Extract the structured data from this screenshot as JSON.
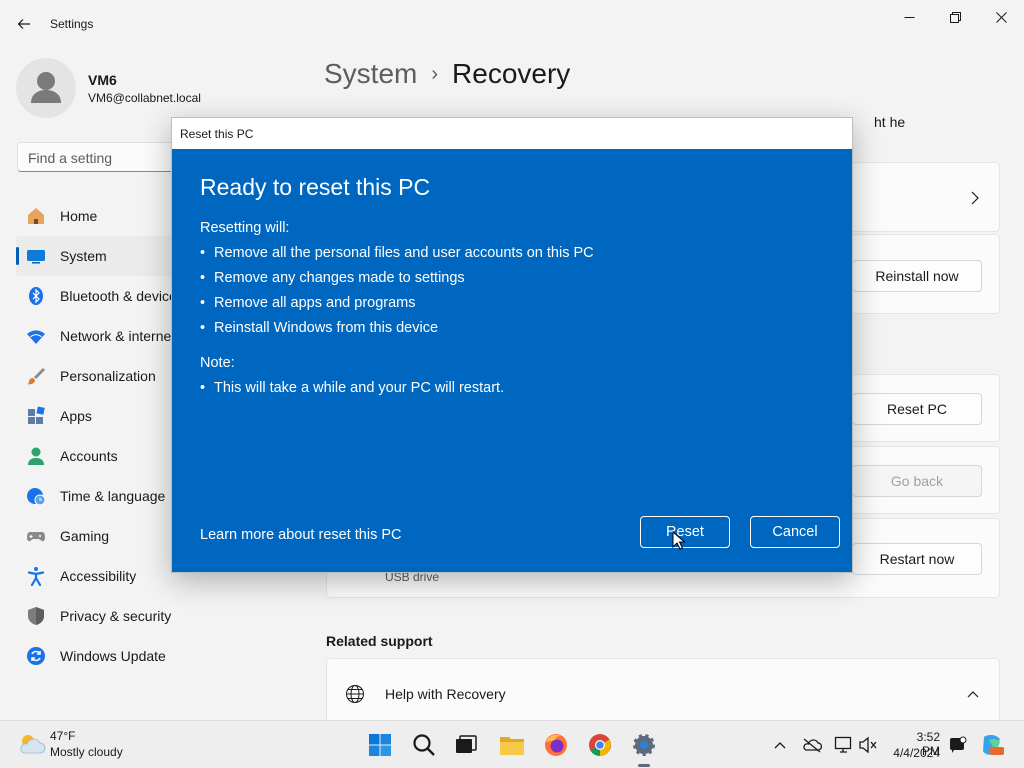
{
  "window": {
    "title": "Settings",
    "minimize_glyph": "—",
    "maximize_glyph": "❐",
    "close_glyph": "✕"
  },
  "user": {
    "name": "VM6",
    "email": "VM6@collabnet.local"
  },
  "search": {
    "placeholder": "Find a setting"
  },
  "sidebar": {
    "items": [
      {
        "label": "Home",
        "icon": "home-icon"
      },
      {
        "label": "System",
        "icon": "system-icon",
        "active": true
      },
      {
        "label": "Bluetooth & devices",
        "icon": "bluetooth-icon"
      },
      {
        "label": "Network & internet",
        "icon": "wifi-icon"
      },
      {
        "label": "Personalization",
        "icon": "brush-icon"
      },
      {
        "label": "Apps",
        "icon": "apps-icon"
      },
      {
        "label": "Accounts",
        "icon": "accounts-icon"
      },
      {
        "label": "Time & language",
        "icon": "globe-clock-icon"
      },
      {
        "label": "Gaming",
        "icon": "gamepad-icon"
      },
      {
        "label": "Accessibility",
        "icon": "accessibility-icon"
      },
      {
        "label": "Privacy & security",
        "icon": "shield-icon"
      },
      {
        "label": "Windows Update",
        "icon": "update-icon"
      }
    ]
  },
  "main": {
    "breadcrumb_parent": "System",
    "breadcrumb_current": "Recovery",
    "intro_tail": "ht help.",
    "reinstall_button": "Reinstall now",
    "reset_button": "Reset PC",
    "goback_button": "Go back",
    "restart_button": "Restart now",
    "advanced_sub": "USB drive",
    "related_support_title": "Related support",
    "help_with_recovery": "Help with Recovery"
  },
  "dialog": {
    "title": "Reset this PC",
    "heading": "Ready to reset this PC",
    "resetting_label": "Resetting will:",
    "resetting_items": [
      "Remove all the personal files and user accounts on this PC",
      "Remove any changes made to settings",
      "Remove all apps and programs",
      "Reinstall Windows from this device"
    ],
    "note_label": "Note:",
    "note_items": [
      "This will take a while and your PC will restart."
    ],
    "bullet": "•",
    "learn_more": "Learn more about reset this PC",
    "reset_button": "Reset",
    "cancel_button": "Cancel"
  },
  "taskbar": {
    "weather_temp": "47°F",
    "weather_desc": "Mostly cloudy",
    "time": "3:52 PM",
    "date": "4/4/2024"
  },
  "colors": {
    "accent": "#0067c0",
    "active_indicator": "#005fb8"
  }
}
